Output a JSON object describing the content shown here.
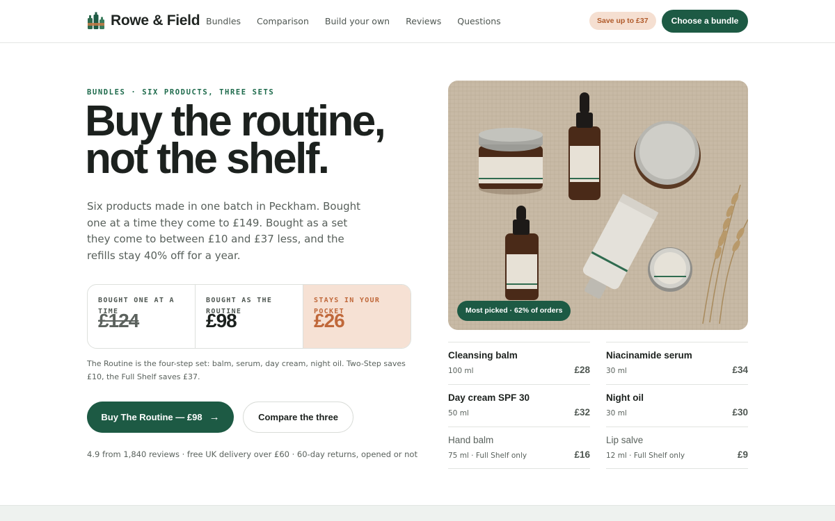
{
  "brand": {
    "name": "Rowe & Field"
  },
  "nav": [
    "Bundles",
    "Comparison",
    "Build your own",
    "Reviews",
    "Questions"
  ],
  "header": {
    "save_badge": "Save up to £37",
    "cta": "Choose a bundle"
  },
  "hero": {
    "eyebrow": "BUNDLES · SIX PRODUCTS, THREE SETS",
    "headline_line1": "Buy the routine,",
    "headline_line2": "not the shelf.",
    "intro": "Six products made in one batch in Peckham. Bought one at a time they come to £149. Bought as a set they come to between £10 and £37 less, and the refills stay 40% off for a year."
  },
  "price_compare": [
    {
      "label": "BOUGHT ONE AT A TIME",
      "value": "£124"
    },
    {
      "label": "BOUGHT AS THE ROUTINE",
      "value": "£98"
    },
    {
      "label": "STAYS IN YOUR POCKET",
      "value": "£26"
    }
  ],
  "note": "The Routine is the four-step set: balm, serum, day cream, night oil. Two-Step saves £10, the Full Shelf saves £37.",
  "actions": {
    "primary": "Buy The Routine — £98",
    "secondary": "Compare the three"
  },
  "trust": "4.9 from 1,840 reviews · free UK delivery over £60 · 60-day returns, opened or not",
  "photo": {
    "badge": "Most picked · 62% of orders"
  },
  "products": [
    {
      "name": "Cleansing balm",
      "size": "100 ml",
      "price": "£28"
    },
    {
      "name": "Niacinamide serum",
      "size": "30 ml",
      "price": "£34"
    },
    {
      "name": "Day cream SPF 30",
      "size": "50 ml",
      "price": "£32"
    },
    {
      "name": "Night oil",
      "size": "30 ml",
      "price": "£30"
    },
    {
      "name": "Hand balm",
      "size": "75 ml · Full Shelf only",
      "price": "£16"
    },
    {
      "name": "Lip salve",
      "size": "12 ml · Full Shelf only",
      "price": "£9"
    }
  ],
  "colors": {
    "brand_green": "#1d5a44",
    "accent_peach": "#f6e1d4",
    "accent_rust": "#c0683a"
  }
}
